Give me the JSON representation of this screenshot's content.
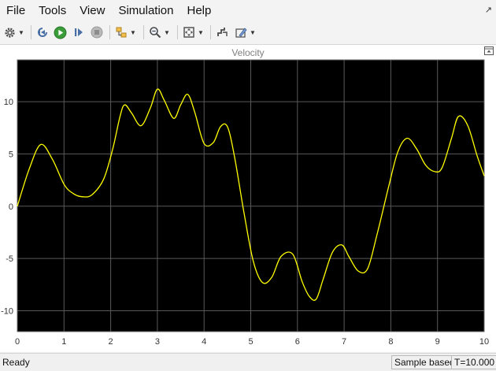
{
  "menu": {
    "items": [
      "File",
      "Tools",
      "View",
      "Simulation",
      "Help"
    ]
  },
  "toolbar": {
    "icons": [
      "gear-icon",
      "step-back-icon",
      "run-icon",
      "step-forward-icon",
      "stop-icon",
      "signal-select-icon",
      "zoom-icon",
      "fit-to-view-icon",
      "cursor-measure-icon",
      "highlight-icon"
    ]
  },
  "plot": {
    "title": "Velocity",
    "background_color": "#000000",
    "line_color": "#ffff00",
    "grid_color": "#595959"
  },
  "chart_data": {
    "type": "line",
    "title": "Velocity",
    "xlabel": "",
    "ylabel": "",
    "xlim": [
      0,
      10
    ],
    "ylim": [
      -12,
      14
    ],
    "x_ticks": [
      "0",
      "1",
      "2",
      "3",
      "4",
      "5",
      "6",
      "7",
      "8",
      "9",
      "10"
    ],
    "y_ticks": [
      "-10",
      "-5",
      "0",
      "5",
      "10"
    ],
    "grid": true,
    "series": [
      {
        "x": [
          0,
          0.25,
          0.5,
          0.75,
          1.0,
          1.2,
          1.4,
          1.6,
          1.85,
          2.05,
          2.2,
          2.3,
          2.45,
          2.65,
          2.85,
          3.0,
          3.15,
          3.35,
          3.5,
          3.65,
          3.8,
          4.0,
          4.2,
          4.35,
          4.5,
          4.65,
          4.85,
          5.05,
          5.25,
          5.45,
          5.65,
          5.9,
          6.1,
          6.25,
          6.4,
          6.55,
          6.75,
          6.95,
          7.1,
          7.3,
          7.5,
          7.7,
          7.95,
          8.15,
          8.35,
          8.55,
          8.75,
          8.95,
          9.1,
          9.3,
          9.45,
          9.65,
          9.85,
          10.0
        ],
        "y": [
          0,
          3.5,
          5.9,
          4.5,
          2.1,
          1.2,
          0.9,
          1.1,
          2.6,
          5.6,
          8.6,
          9.7,
          8.9,
          7.7,
          9.4,
          11.2,
          10.1,
          8.4,
          9.7,
          10.7,
          9.0,
          6.0,
          6.1,
          7.6,
          7.6,
          4.8,
          -0.5,
          -5.2,
          -7.3,
          -6.8,
          -4.8,
          -4.6,
          -7.2,
          -8.6,
          -8.9,
          -7.0,
          -4.4,
          -3.7,
          -4.8,
          -6.2,
          -6.0,
          -2.8,
          1.8,
          5.2,
          6.5,
          5.5,
          3.9,
          3.3,
          3.7,
          6.5,
          8.6,
          7.7,
          4.8,
          2.9
        ]
      }
    ]
  },
  "status": {
    "ready": "Ready",
    "sample_mode": "Sample based",
    "time": "T=10.000"
  }
}
